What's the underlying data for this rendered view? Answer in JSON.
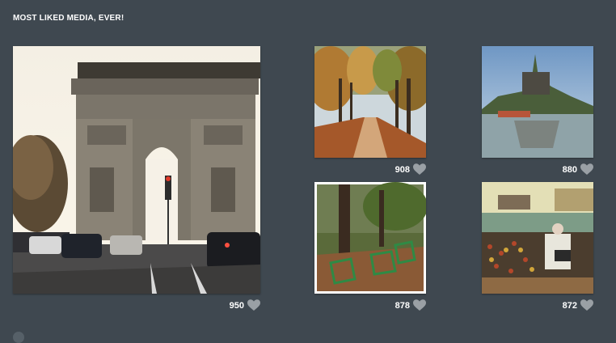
{
  "section_title": "MOST LIKED MEDIA, EVER!",
  "media": [
    {
      "scene": "arc-de-triomphe",
      "likes": "950"
    },
    {
      "scene": "autumn-tree-alley",
      "likes": "908"
    },
    {
      "scene": "mont-saint-michel",
      "likes": "880"
    },
    {
      "scene": "park-green-chairs",
      "likes": "878"
    },
    {
      "scene": "love-locks-bridge-accordion-player",
      "likes": "872"
    }
  ],
  "icons": {
    "like": "heart-icon"
  },
  "colors": {
    "background": "#3f4850",
    "heart": "#9aa0a5",
    "text": "#ffffff"
  }
}
